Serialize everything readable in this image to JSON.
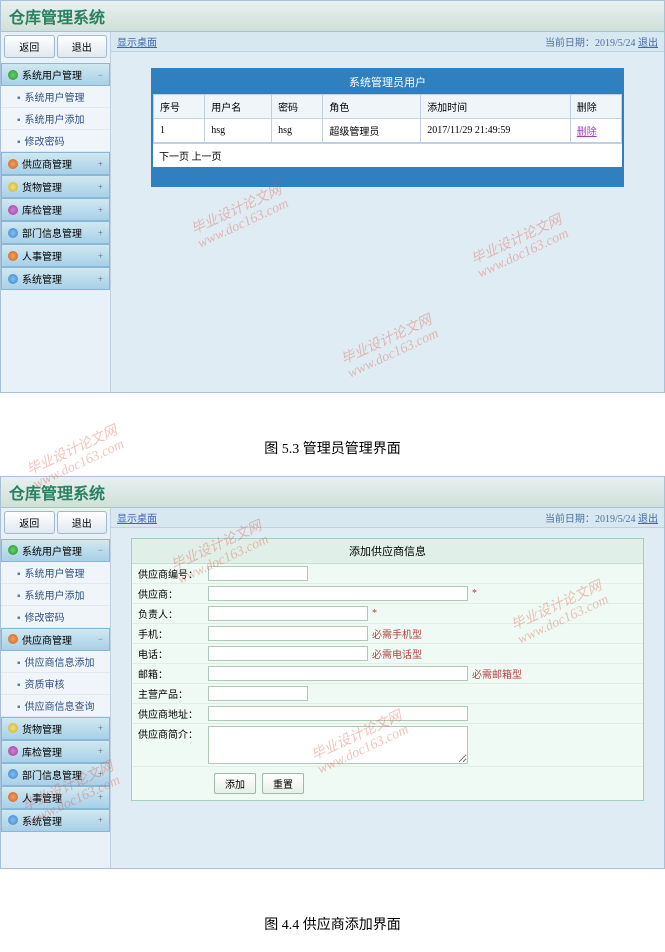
{
  "app_title": "仓库管理系统",
  "top_buttons": {
    "back": "返回",
    "exit": "退出"
  },
  "crumb": {
    "show_desktop": "显示桌面",
    "date_prefix": "当前日期：",
    "date": "2019/5/24",
    "logout": "退出"
  },
  "sidebar1": {
    "sections": [
      {
        "title": "系统用户管理",
        "ico": "",
        "items": [
          "系统用户管理",
          "系统用户添加",
          "修改密码"
        ]
      },
      {
        "title": "供应商管理",
        "ico": "r",
        "items": []
      },
      {
        "title": "货物管理",
        "ico": "y",
        "items": []
      },
      {
        "title": "库检管理",
        "ico": "p",
        "items": []
      },
      {
        "title": "部门信息管理",
        "ico": "b",
        "items": []
      },
      {
        "title": "人事管理",
        "ico": "r",
        "items": []
      },
      {
        "title": "系统管理",
        "ico": "b",
        "items": []
      }
    ]
  },
  "sidebar2": {
    "sections": [
      {
        "title": "系统用户管理",
        "ico": "",
        "items": [
          "系统用户管理",
          "系统用户添加",
          "修改密码"
        ]
      },
      {
        "title": "供应商管理",
        "ico": "r",
        "items": [
          "供应商信息添加",
          "资质审核",
          "供应商信息查询"
        ]
      },
      {
        "title": "货物管理",
        "ico": "y",
        "items": []
      },
      {
        "title": "库检管理",
        "ico": "p",
        "items": []
      },
      {
        "title": "部门信息管理",
        "ico": "b",
        "items": []
      },
      {
        "title": "人事管理",
        "ico": "r",
        "items": []
      },
      {
        "title": "系统管理",
        "ico": "b",
        "items": []
      }
    ]
  },
  "panel1": {
    "title": "系统管理员用户",
    "cols": [
      "序号",
      "用户名",
      "密码",
      "角色",
      "添加时间",
      "删除"
    ],
    "rows": [
      {
        "idx": "1",
        "user": "hsg",
        "pwd": "hsg",
        "role": "超级管理员",
        "time": "2017/11/29 21:49:59",
        "action": "删除"
      }
    ],
    "pager": "下一页 上一页"
  },
  "caption1": "图 5.3  管理员管理界面",
  "form": {
    "title": "添加供应商信息",
    "fields": {
      "code": "供应商编号：",
      "name": "供应商：",
      "owner": "负责人：",
      "mobile": "手机：",
      "tel": "电话：",
      "email": "邮箱：",
      "biz": "主营产品：",
      "addr": "供应商地址：",
      "intro": "供应商简介："
    },
    "hints": {
      "star": "*",
      "mobile": "必需手机型",
      "tel": "必需电话型",
      "email": "必需邮箱型"
    },
    "buttons": {
      "add": "添加",
      "reset": "重置"
    }
  },
  "caption2": "图 4.4 供应商添加界面",
  "watermark": {
    "line1": "毕业设计论文网",
    "line2": "www.doc163.com"
  }
}
